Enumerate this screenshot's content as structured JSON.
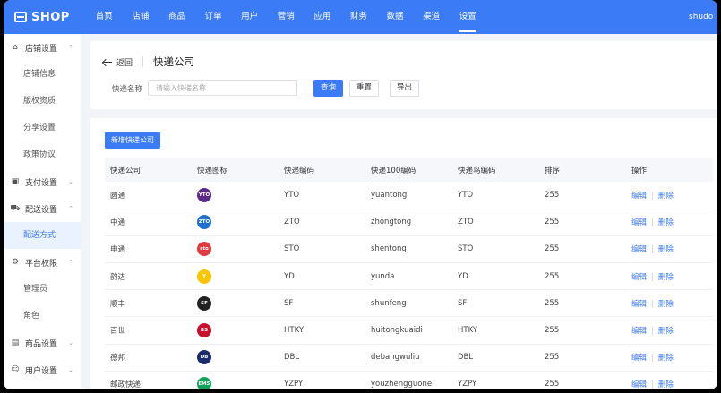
{
  "app": {
    "logo_text": "SHOP",
    "user": "shudo"
  },
  "nav": [
    "首页",
    "店铺",
    "商品",
    "订单",
    "用户",
    "营销",
    "应用",
    "财务",
    "数据",
    "渠道",
    "设置"
  ],
  "nav_active": 10,
  "sidebar": [
    {
      "type": "group",
      "label": "店铺设置",
      "icon": "store-icon",
      "chevron": "⌃"
    },
    {
      "type": "item",
      "label": "店铺信息"
    },
    {
      "type": "item",
      "label": "版权资质"
    },
    {
      "type": "item",
      "label": "分享设置"
    },
    {
      "type": "item",
      "label": "政策协议"
    },
    {
      "type": "group",
      "label": "支付设置",
      "icon": "payment-icon",
      "chevron": "⌄"
    },
    {
      "type": "group",
      "label": "配送设置",
      "icon": "truck-icon",
      "chevron": "⌃"
    },
    {
      "type": "item",
      "label": "配送方式",
      "active": true
    },
    {
      "type": "group",
      "label": "平台权限",
      "icon": "permission-icon",
      "chevron": "⌃"
    },
    {
      "type": "item",
      "label": "管理员"
    },
    {
      "type": "item",
      "label": "角色"
    },
    {
      "type": "group",
      "label": "商品设置",
      "icon": "goods-icon",
      "chevron": "⌄"
    },
    {
      "type": "group",
      "label": "用户设置",
      "icon": "user-icon",
      "chevron": "⌄"
    }
  ],
  "header": {
    "back_label": "返回",
    "title": "快递公司"
  },
  "filter": {
    "label": "快递名称",
    "placeholder": "请输入快递名称",
    "search_label": "查询",
    "reset_label": "重置",
    "export_label": "导出"
  },
  "list": {
    "add_label": "新增快递公司",
    "columns": [
      "快递公司",
      "快递图标",
      "快递编码",
      "快递100编码",
      "快递鸟编码",
      "排序",
      "操作"
    ],
    "edit_label": "编辑",
    "delete_label": "删除",
    "rows": [
      {
        "name": "圆通",
        "logo": "YTO",
        "logo_color": "#5b2a86",
        "code": "YTO",
        "code100": "yuantong",
        "codeniao": "YTO",
        "sort": "255"
      },
      {
        "name": "中通",
        "logo": "ZTO",
        "logo_color": "#1f6fcf",
        "code": "ZTO",
        "code100": "zhongtong",
        "codeniao": "ZTO",
        "sort": "255"
      },
      {
        "name": "申通",
        "logo": "sto",
        "logo_color": "#e0393e",
        "code": "STO",
        "code100": "shentong",
        "codeniao": "STO",
        "sort": "255"
      },
      {
        "name": "韵达",
        "logo": "Y",
        "logo_color": "#f7c600",
        "code": "YD",
        "code100": "yunda",
        "codeniao": "YD",
        "sort": "255"
      },
      {
        "name": "顺丰",
        "logo": "SF",
        "logo_color": "#222222",
        "code": "SF",
        "code100": "shunfeng",
        "codeniao": "SF",
        "sort": "255"
      },
      {
        "name": "百世",
        "logo": "BS",
        "logo_color": "#c8102e",
        "code": "HTKY",
        "code100": "huitongkuaidi",
        "codeniao": "HTKY",
        "sort": "255"
      },
      {
        "name": "德邦",
        "logo": "DB",
        "logo_color": "#1c2a6e",
        "code": "DBL",
        "code100": "debangwuliu",
        "codeniao": "DBL",
        "sort": "255"
      },
      {
        "name": "邮政快递",
        "logo": "EMS",
        "logo_color": "#12a35a",
        "code": "YZPY",
        "code100": "youzhengguonei",
        "codeniao": "YZPY",
        "sort": "255"
      }
    ]
  }
}
